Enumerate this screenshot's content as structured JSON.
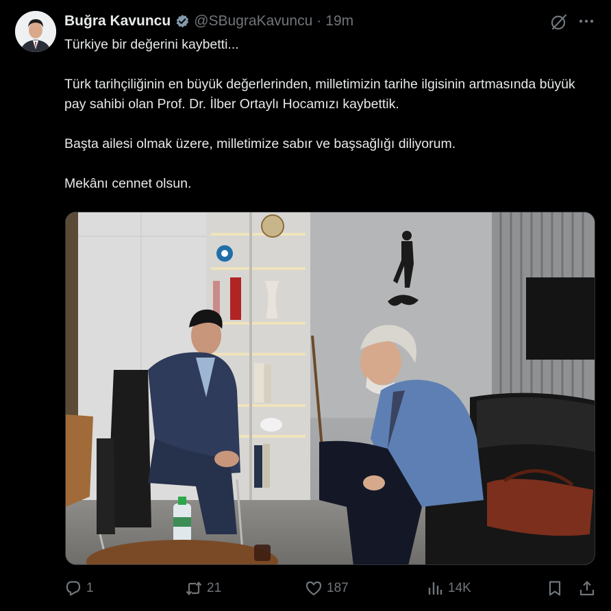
{
  "author": {
    "name": "Buğra Kavuncu",
    "handle": "@SBugraKavuncu",
    "separator": "·",
    "time": "19m",
    "verified_color": "#829aab"
  },
  "tweet": {
    "paragraphs": [
      "Türkiye bir değerini kaybetti...",
      "Türk tarihçiliğinin en büyük değerlerinden, milletimizin tarihe ilgisinin artmasında büyük pay sahibi olan Prof. Dr. İlber Ortaylı Hocamızı kaybettik.",
      "Başta ailesi olmak üzere, milletimize sabır ve başsağlığı diliyorum.",
      "Mekânı cennet olsun."
    ]
  },
  "actions": {
    "replies": "1",
    "reposts": "21",
    "likes": "187",
    "views": "14K"
  },
  "icons": {
    "header": [
      "grok-icon",
      "more-icon"
    ],
    "actions": [
      "reply-icon",
      "repost-icon",
      "like-icon",
      "views-icon",
      "bookmark-icon",
      "share-icon"
    ]
  },
  "colors": {
    "background": "#000000",
    "text": "#e7e9ea",
    "secondary": "#71767b"
  }
}
